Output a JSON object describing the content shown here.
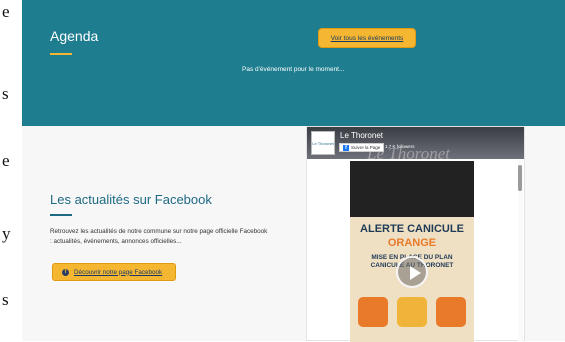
{
  "margin_letters": [
    "e",
    "s",
    "e",
    "y",
    "s"
  ],
  "agenda": {
    "title": "Agenda",
    "button_label": "Voir tous les événements",
    "empty_text": "Pas d'événement pour le moment..."
  },
  "facebook_section": {
    "title": "Les actualités sur Facebook",
    "description": "Retrouvez les actualités de notre commune sur notre page officielle Facebook : actualités, événements, annonces officielles...",
    "button_label": "Découvrir notre page Facebook",
    "button_icon": "facebook-icon"
  },
  "embed": {
    "page_name": "Le Thoronet",
    "follow_label": "Suivre la Page",
    "followers": "1,7 K followers",
    "cover_text": "Le Thoronet",
    "logo_text": "Le Thoronet",
    "post": {
      "line1": "ALERTE CANICULE",
      "line2": "ORANGE",
      "line3": "MISE EN PLACE DU PLAN",
      "line4": "CANICULE AU THORONET"
    }
  },
  "colors": {
    "teal": "#1e7d8f",
    "accent": "#f5b731",
    "title_blue": "#1e6a85",
    "poster_orange": "#e97a2a"
  }
}
